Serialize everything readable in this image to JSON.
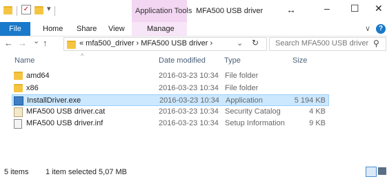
{
  "titlebar": {
    "context_tab": "Application Tools",
    "window_title": "MFA500 USB driver",
    "resize_glyph": "↔",
    "minimize": "–",
    "maximize": "☐",
    "close": "✕"
  },
  "ribbon": {
    "file": "File",
    "home": "Home",
    "share": "Share",
    "view": "View",
    "manage": "Manage",
    "expand": "∨",
    "help": "?"
  },
  "address": {
    "back": "←",
    "forward": "→",
    "recent": "⌄",
    "up": "↑",
    "path": "«  mfa500_driver  ›  MFA500 USB driver  ›",
    "history": "⌄",
    "refresh": "↻",
    "search_placeholder": "Search MFA500 USB driver",
    "search_glyph": "⚲"
  },
  "columns": {
    "name": "Name",
    "date": "Date modified",
    "type": "Type",
    "size": "Size",
    "sort_glyph": "^"
  },
  "files": [
    {
      "name": "amd64",
      "date": "2016-03-23 10:34",
      "type": "File folder",
      "size": "",
      "icon": "folder-icon"
    },
    {
      "name": "x86",
      "date": "2016-03-23 10:34",
      "type": "File folder",
      "size": "",
      "icon": "folder-icon"
    },
    {
      "name": "InstallDriver.exe",
      "date": "2016-03-23 10:34",
      "type": "Application",
      "size": "5 194 KB",
      "icon": "application-icon",
      "selected": true
    },
    {
      "name": "MFA500 USB driver.cat",
      "date": "2016-03-23 10:34",
      "type": "Security Catalog",
      "size": "4 KB",
      "icon": "security-catalog-icon"
    },
    {
      "name": "MFA500 USB driver.inf",
      "date": "2016-03-23 10:34",
      "type": "Setup Information",
      "size": "9 KB",
      "icon": "setup-information-icon"
    }
  ],
  "status": {
    "items": "5 items",
    "selection": "1 item selected  5,07 MB"
  },
  "colors": {
    "file_tab": "#1979ca",
    "context_tab": "#f2d6f2",
    "selection": "#cce8ff",
    "folder": "#f5c542"
  }
}
